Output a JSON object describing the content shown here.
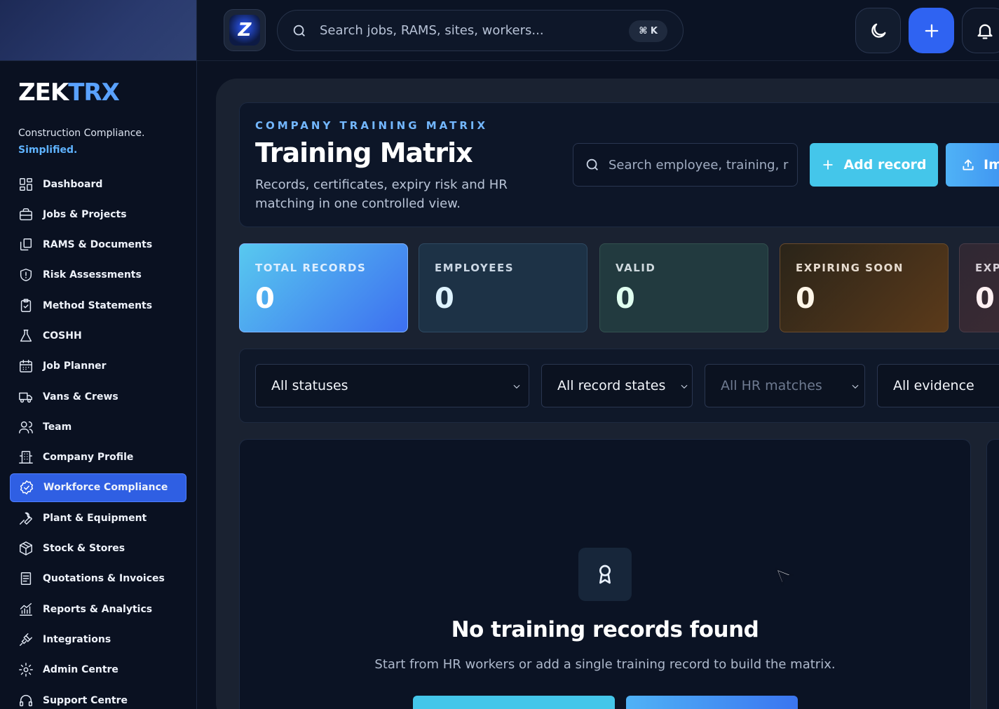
{
  "sidebar": {
    "logo_white": "ZEK",
    "logo_blue": "TRX",
    "tagline_line1": "Construction Compliance.",
    "tagline_line2": "Simplified.",
    "items": [
      {
        "label": "Dashboard",
        "icon": "dashboard-icon"
      },
      {
        "label": "Jobs & Projects",
        "icon": "briefcase-icon"
      },
      {
        "label": "RAMS & Documents",
        "icon": "documents-icon"
      },
      {
        "label": "Risk Assessments",
        "icon": "shield-icon"
      },
      {
        "label": "Method Statements",
        "icon": "clipboard-icon"
      },
      {
        "label": "COSHH",
        "icon": "flask-icon"
      },
      {
        "label": "Job Planner",
        "icon": "calendar-icon"
      },
      {
        "label": "Vans & Crews",
        "icon": "truck-icon"
      },
      {
        "label": "Team",
        "icon": "users-icon"
      },
      {
        "label": "Company Profile",
        "icon": "building-icon"
      },
      {
        "label": "Workforce Compliance",
        "icon": "badge-check-icon",
        "active": true
      },
      {
        "label": "Plant & Equipment",
        "icon": "wrench-icon"
      },
      {
        "label": "Stock & Stores",
        "icon": "box-icon"
      },
      {
        "label": "Quotations & Invoices",
        "icon": "receipt-icon"
      },
      {
        "label": "Reports & Analytics",
        "icon": "chart-icon"
      },
      {
        "label": "Integrations",
        "icon": "plug-icon"
      },
      {
        "label": "Admin Centre",
        "icon": "gear-icon"
      },
      {
        "label": "Support Centre",
        "icon": "headset-icon"
      }
    ]
  },
  "topbar": {
    "app_icon_letter": "Z",
    "search_placeholder": "Search jobs, RAMS, sites, workers...",
    "shortcut": "⌘ K"
  },
  "hero": {
    "eyebrow": "COMPANY TRAINING MATRIX",
    "title": "Training Matrix",
    "subtitle": "Records, certificates, expiry risk and HR matching in one controlled view.",
    "search_placeholder": "Search employee, training, r",
    "add_label": "Add record",
    "import_label": "Im"
  },
  "stats": [
    {
      "label": "TOTAL RECORDS",
      "value": "0"
    },
    {
      "label": "EMPLOYEES",
      "value": "0"
    },
    {
      "label": "VALID",
      "value": "0"
    },
    {
      "label": "EXPIRING SOON",
      "value": "0"
    },
    {
      "label": "EXP",
      "value": "0"
    }
  ],
  "filters": {
    "status": "All statuses",
    "record_state": "All record states",
    "hr_match": "All HR matches",
    "evidence": "All evidence"
  },
  "empty_state": {
    "title": "No training records found",
    "subtitle": "Start from HR workers or add a single training record to build the matrix."
  },
  "colors": {
    "accent": "#2f63f2",
    "cyan": "#44c6ea",
    "brand_blue": "#5aa2ff"
  }
}
